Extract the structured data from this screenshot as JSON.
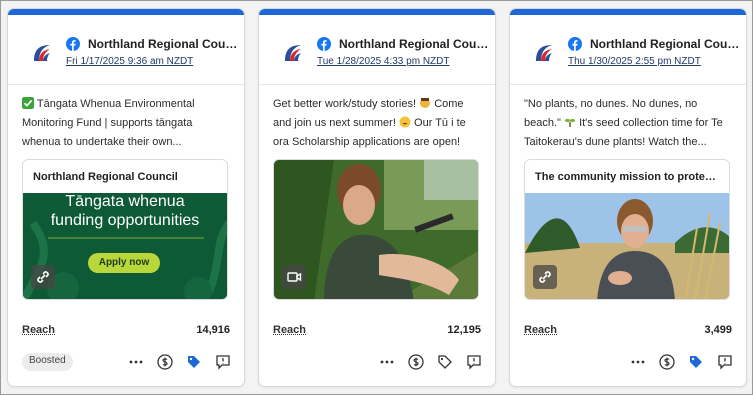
{
  "posts": [
    {
      "page_name": "Northland Regional Council",
      "date": "Fri 1/17/2025 9:36 am NZDT",
      "text_before": "",
      "text_after": "Tāngata Whenua Environmental Monitoring Fund | supports tāngata whenua to undertake their own...",
      "media_title": "Northland Regional Council",
      "media_line1": "Tāngata whenua",
      "media_line2": "funding opportunities",
      "media_button": "Apply now",
      "media_icon": "link-icon",
      "reach_label": "Reach",
      "reach_value": "14,916",
      "badge": "Boosted",
      "icons": [
        "more-icon",
        "dollar-icon",
        "tag-filled-icon",
        "comment-icon"
      ]
    },
    {
      "page_name": "Northland Regional Council",
      "date": "Tue 1/28/2025 4:33 pm NZDT",
      "text_before": "Get better work/study stories!",
      "text_mid": "Come and join us next summer!",
      "text_after": "Our Tū i te ora Scholarship applications are open!",
      "media_icon": "video-icon",
      "reach_label": "Reach",
      "reach_value": "12,195",
      "icons": [
        "more-icon",
        "dollar-icon",
        "tag-outline-icon",
        "comment-icon"
      ]
    },
    {
      "page_name": "Northland Regional Council",
      "date": "Thu 1/30/2025 2:55 pm NZDT",
      "text_before": "\"No plants, no dunes. No dunes, no beach.\"",
      "text_after": "It's seed collection time for Te Taitokerau's dune plants! Watch the...",
      "media_title": "The community mission to protect...",
      "media_icon": "link-icon",
      "reach_label": "Reach",
      "reach_value": "3,499",
      "icons": [
        "more-icon",
        "dollar-icon",
        "tag-filled-icon",
        "comment-icon"
      ]
    }
  ],
  "colors": {
    "accent": "#1e67d8",
    "facebook": "#1877f2",
    "check": "#3da33d"
  }
}
